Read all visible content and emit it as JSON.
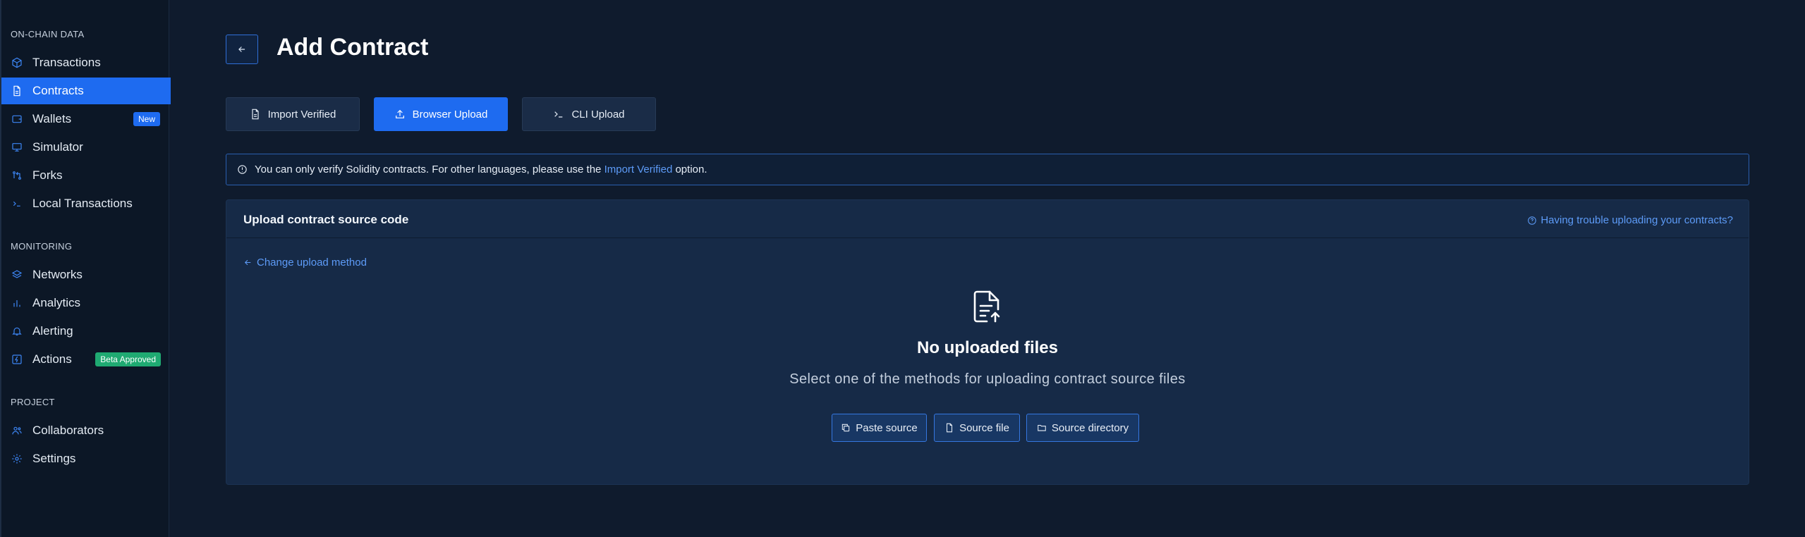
{
  "sidebar": {
    "sections": [
      {
        "title": "ON-CHAIN DATA"
      },
      {
        "title": "MONITORING"
      },
      {
        "title": "PROJECT"
      }
    ],
    "items": [
      {
        "label": "Transactions",
        "icon": "cube-icon"
      },
      {
        "label": "Contracts",
        "icon": "document-icon",
        "active": true
      },
      {
        "label": "Wallets",
        "icon": "wallet-icon",
        "badge": "New"
      },
      {
        "label": "Simulator",
        "icon": "monitor-icon"
      },
      {
        "label": "Forks",
        "icon": "git-fork-icon"
      },
      {
        "label": "Local Transactions",
        "icon": "terminal-icon"
      },
      {
        "label": "Networks",
        "icon": "layers-icon"
      },
      {
        "label": "Analytics",
        "icon": "bar-chart-icon"
      },
      {
        "label": "Alerting",
        "icon": "bell-icon"
      },
      {
        "label": "Actions",
        "icon": "bolt-icon",
        "badge": "Beta Approved"
      },
      {
        "label": "Collaborators",
        "icon": "users-icon"
      },
      {
        "label": "Settings",
        "icon": "gear-icon"
      }
    ]
  },
  "header": {
    "title": "Add Contract"
  },
  "methods": [
    {
      "label": "Import Verified",
      "icon": "document-icon"
    },
    {
      "label": "Browser Upload",
      "icon": "upload-icon",
      "active": true
    },
    {
      "label": "CLI Upload",
      "icon": "terminal-icon"
    }
  ],
  "info": {
    "text_before": "You can only verify Solidity contracts. For other languages, please use the",
    "link": "Import Verified",
    "text_after": "option."
  },
  "panel": {
    "title": "Upload contract source code",
    "help_link": "Having trouble uploading your contracts?",
    "change_link": "Change upload method",
    "empty_title": "No uploaded files",
    "empty_subtitle": "Select one of the methods for uploading contract source files",
    "buttons": [
      {
        "label": "Paste source",
        "icon": "copy-icon"
      },
      {
        "label": "Source file",
        "icon": "file-icon"
      },
      {
        "label": "Source directory",
        "icon": "folder-icon"
      }
    ]
  },
  "colors": {
    "accent": "#1e6bf0",
    "background": "#0f1b2d",
    "sidebar": "#0c1726",
    "panel": "#162a47",
    "link": "#5d9bf7",
    "beta_badge": "#1faa72"
  }
}
